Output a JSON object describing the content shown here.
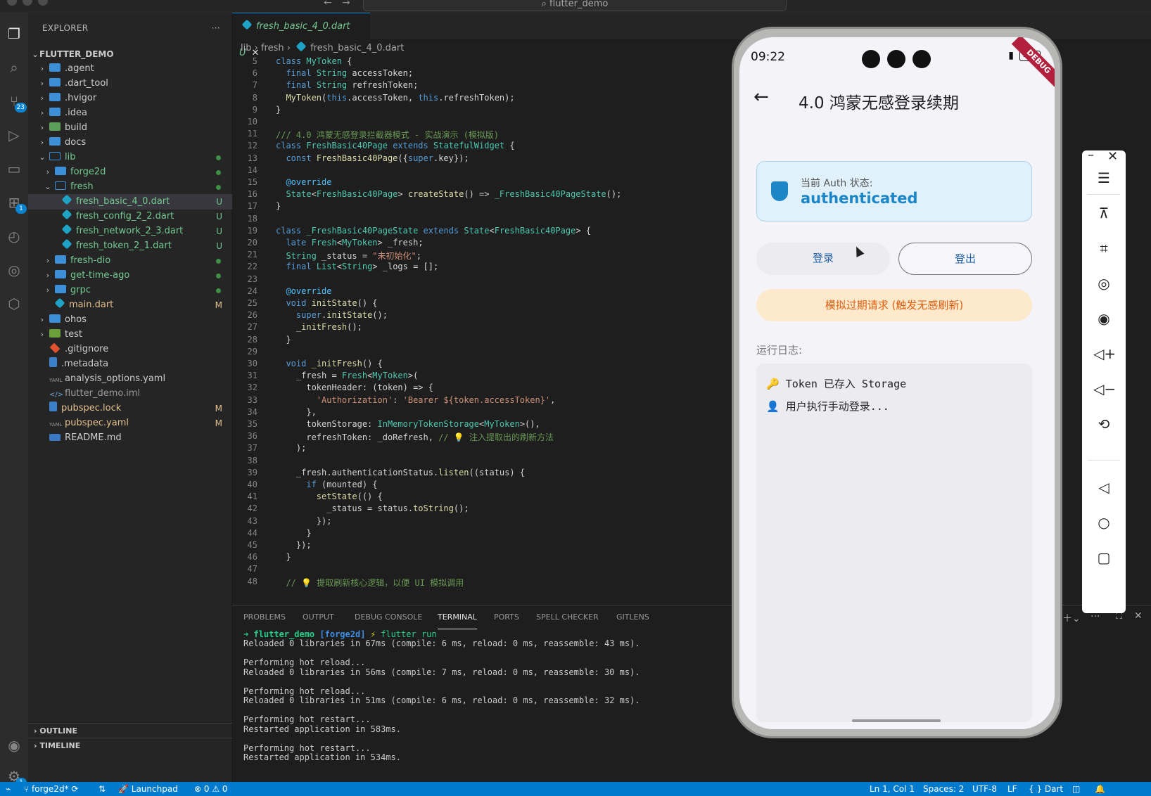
{
  "window": {
    "search_text": "⌕ flutter_demo"
  },
  "activity_bar": {
    "source_control_badge": "23",
    "extensions_badge": "1",
    "settings_badge": "1"
  },
  "explorer": {
    "title": "EXPLORER",
    "root": "FLUTTER_DEMO",
    "items": [
      {
        "label": ".agent",
        "status": ""
      },
      {
        "label": ".dart_tool",
        "status": ""
      },
      {
        "label": ".hvigor",
        "status": ""
      },
      {
        "label": ".idea",
        "status": ""
      },
      {
        "label": "build",
        "status": ""
      },
      {
        "label": "docs",
        "status": ""
      },
      {
        "label": "lib",
        "status": "dot"
      },
      {
        "label": "forge2d",
        "status": "dot"
      },
      {
        "label": "fresh",
        "status": "dot"
      },
      {
        "label": "fresh_basic_4_0.dart",
        "status": "U"
      },
      {
        "label": "fresh_config_2_2.dart",
        "status": "U"
      },
      {
        "label": "fresh_network_2_3.dart",
        "status": "U"
      },
      {
        "label": "fresh_token_2_1.dart",
        "status": "U"
      },
      {
        "label": "fresh-dio",
        "status": "dot"
      },
      {
        "label": "get-time-ago",
        "status": "dot"
      },
      {
        "label": "grpc",
        "status": "dot"
      },
      {
        "label": "main.dart",
        "status": "M"
      },
      {
        "label": "ohos",
        "status": ""
      },
      {
        "label": "test",
        "status": ""
      },
      {
        "label": ".gitignore",
        "status": ""
      },
      {
        "label": ".metadata",
        "status": ""
      },
      {
        "label": "analysis_options.yaml",
        "status": ""
      },
      {
        "label": "flutter_demo.iml",
        "status": ""
      },
      {
        "label": "pubspec.lock",
        "status": "M"
      },
      {
        "label": "pubspec.yaml",
        "status": "M"
      },
      {
        "label": "README.md",
        "status": ""
      }
    ],
    "outline": "OUTLINE",
    "timeline": "TIMELINE"
  },
  "editor": {
    "tab_label": "fresh_basic_4_0.dart",
    "tab_status": "U",
    "breadcrumb": [
      "lib",
      "fresh",
      "fresh_basic_4_0.dart"
    ],
    "line_numbers": [
      "5",
      "6",
      "7",
      "8",
      "9",
      "10",
      "11",
      "12",
      "13",
      "14",
      "15",
      "16",
      "17",
      "18",
      "19",
      "20",
      "21",
      "22",
      "23",
      "24",
      "25",
      "26",
      "27",
      "28",
      "29",
      "30",
      "31",
      "32",
      "33",
      "34",
      "35",
      "36",
      "37",
      "38",
      "39",
      "40",
      "41",
      "42",
      "43",
      "44",
      "45",
      "46",
      "47",
      "48"
    ]
  },
  "panel": {
    "tabs": [
      "PROBLEMS",
      "OUTPUT",
      "DEBUG CONSOLE",
      "TERMINAL",
      "PORTS",
      "SPELL CHECKER",
      "GITLENS"
    ],
    "prompt_dir": "flutter_demo",
    "prompt_branch": "[forge2d]",
    "prompt_cmd": "flutter run",
    "output": "Reloaded 0 libraries in 67ms (compile: 6 ms, reload: 0 ms, reassemble: 43 ms).\n\nPerforming hot reload...\nReloaded 0 libraries in 56ms (compile: 7 ms, reload: 0 ms, reassemble: 30 ms).\n\nPerforming hot reload...\nReloaded 0 libraries in 51ms (compile: 6 ms, reload: 0 ms, reassemble: 32 ms).\n\nPerforming hot restart...\nRestarted application in 583ms.\n\nPerforming hot restart...\nRestarted application in 534ms."
  },
  "statusbar": {
    "branch": "forge2d*",
    "launchpad": "Launchpad",
    "problems": "⊗ 0 ⚠ 0",
    "position": "Ln 1, Col 1",
    "spaces": "Spaces: 2",
    "encoding": "UTF-8",
    "eol": "LF",
    "language": "{ } Dart"
  },
  "phone": {
    "time": "09:22",
    "battery": "100",
    "debug_banner": "DEBUG",
    "title": "4.0 鸿蒙无感登录续期",
    "auth_label": "当前 Auth 状态:",
    "auth_value": "authenticated",
    "login_button": "登录",
    "logout_button": "登出",
    "expire_button": "模拟过期请求 (触发无感刷新)",
    "log_title": "运行日志:",
    "logs": [
      "🔑 Token 已存入 Storage",
      "👤 用户执行手动登录..."
    ]
  }
}
